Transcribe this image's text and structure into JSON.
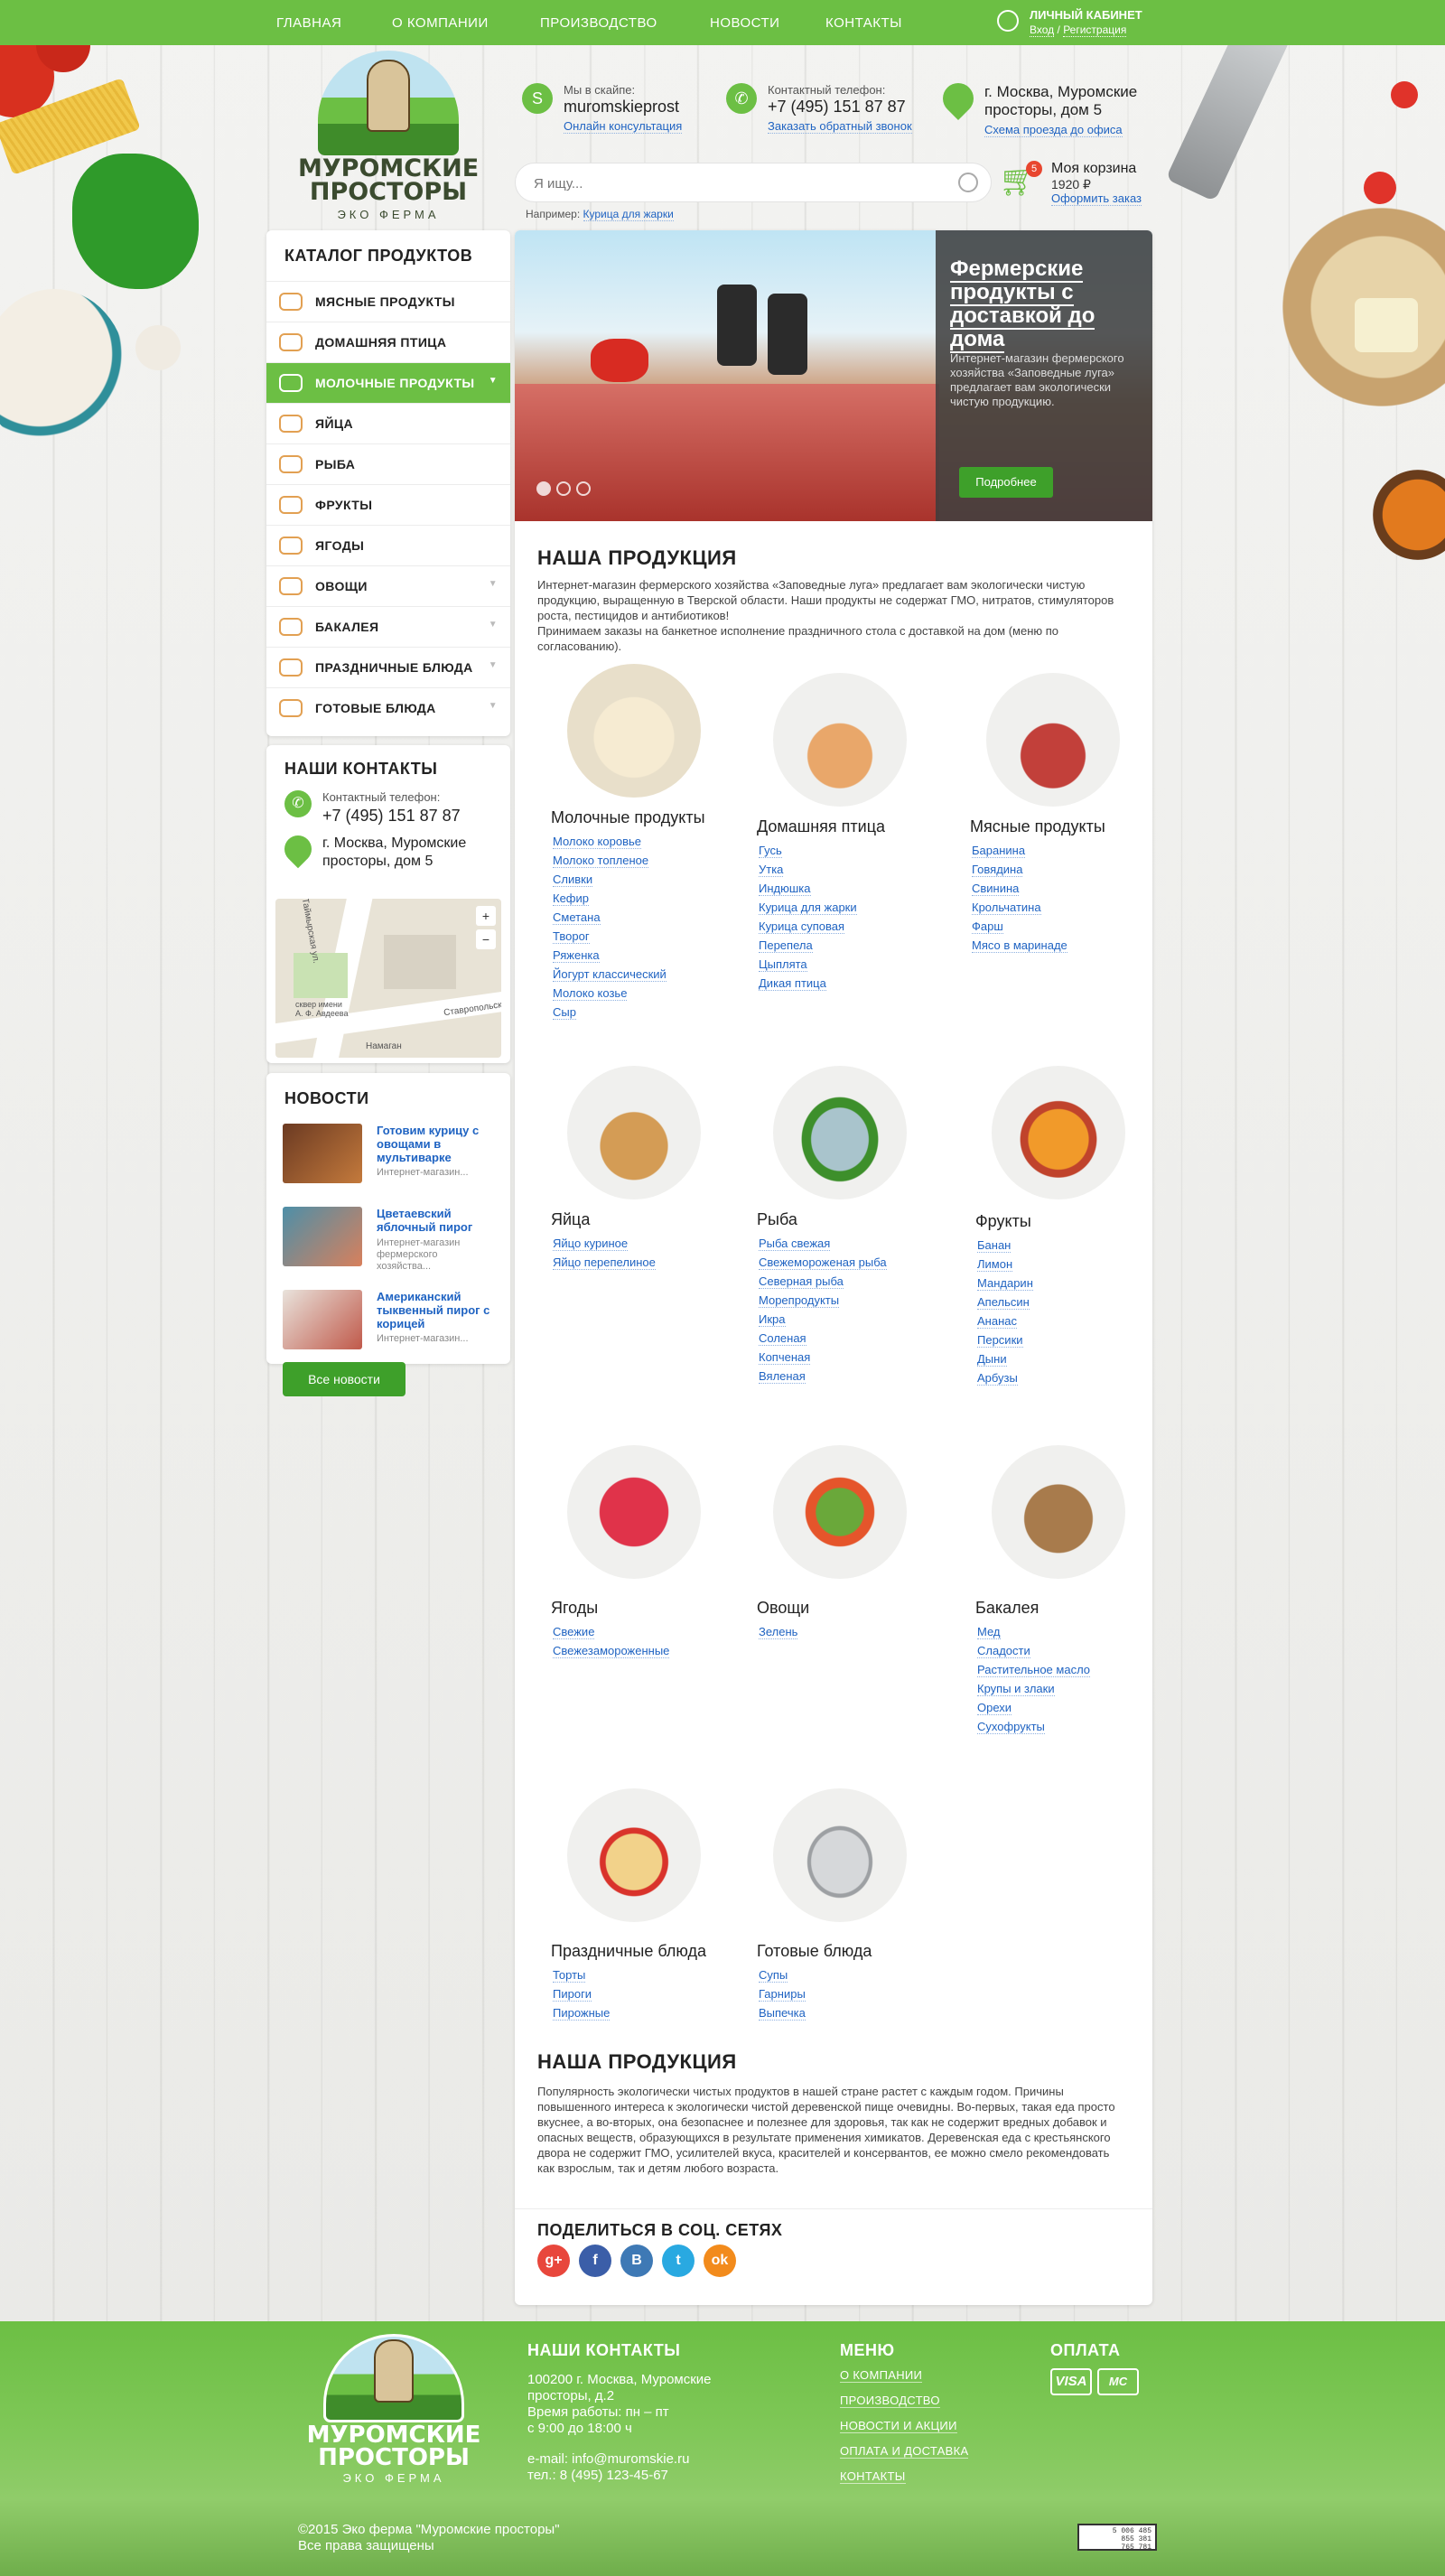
{
  "nav": {
    "items": [
      "ГЛАВНАЯ",
      "О КОМПАНИИ",
      "ПРОИЗВОДСТВО",
      "НОВОСТИ",
      "КОНТАКТЫ"
    ],
    "cabinet_title": "ЛИЧНЫЙ КАБИНЕТ",
    "login": "Вход",
    "separator": "/",
    "register": "Регистрация"
  },
  "logo": {
    "line1": "МУРОМСКИЕ",
    "line2": "ПРОСТОРЫ",
    "sub": "ЭКО ФЕРМА"
  },
  "header": {
    "skype_label": "Мы в скайпе:",
    "skype_value": "muromskieprost",
    "skype_link": "Онлайн консультация",
    "phone_label": "Контактный телефон:",
    "phone_value": "+7 (495) 151 87 87",
    "phone_link": "Заказать обратный звонок",
    "address_line1": "г. Москва, Муромские",
    "address_line2": "просторы, дом 5",
    "address_link": "Схема проезда до офиса"
  },
  "search": {
    "placeholder": "Я ищу...",
    "example_label": "Например:",
    "example_link": "Курица для жарки"
  },
  "cart": {
    "count": "5",
    "title": "Моя корзина",
    "sum": "1920 ₽",
    "link": "Оформить заказ"
  },
  "catalog": {
    "title": "КАТАЛОГ ПРОДУКТОВ",
    "items": [
      "МЯСНЫЕ ПРОДУКТЫ",
      "ДОМАШНЯЯ ПТИЦА",
      "МОЛОЧНЫЕ ПРОДУКТЫ",
      "ЯЙЦА",
      "РЫБА",
      "ФРУКТЫ",
      "ЯГОДЫ",
      "ОВОЩИ",
      "БАКАЛЕЯ",
      "ПРАЗДНИЧНЫЕ БЛЮДА",
      "ГОТОВЫЕ БЛЮДА"
    ]
  },
  "contacts": {
    "title": "НАШИ КОНТАКТЫ",
    "phone_label": "Контактный телефон:",
    "phone": "+7 (495) 151 87 87",
    "address1": "г. Москва, Муромские",
    "address2": "просторы, дом 5",
    "map_street1": "Таймырская ул.",
    "map_street2": "Ставропольская",
    "map_square": "сквер имени А. Ф. Авдеева",
    "map_shop": "Намаган",
    "map_zoom_in": "+",
    "map_zoom_out": "−"
  },
  "news": {
    "title": "НОВОСТИ",
    "items": [
      {
        "title": "Готовим курицу с овощами в мультиварке",
        "desc": "Интернет-магазин..."
      },
      {
        "title": "Цветаевский яблочный пирог",
        "desc": "Интернет-магазин фермерского хозяйства..."
      },
      {
        "title": "Американский тыквенный пирог с корицей",
        "desc": "Интернет-магазин..."
      }
    ],
    "all_button": "Все новости"
  },
  "banner": {
    "title": "Фермерские продукты с доставкой до дома",
    "desc": "Интернет-магазин фермерского хозяйства «Заповедные луга» предлагает вам экологически чистую продукцию.",
    "button": "Подробнее"
  },
  "products_section": {
    "title": "НАША ПРОДУКЦИЯ",
    "intro": "Интернет-магазин фермерского хозяйства «Заповедные луга» предлагает вам экологически чистую продукцию, выращенную в Тверской области. Наши продукты не содержат ГМО, нитратов, стимуляторов роста, пестицидов и антибиотиков!",
    "intro2": "Принимаем заказы на банкетное исполнение праздничного стола с доставкой на дом (меню по согласованию).",
    "categories": [
      {
        "title": "Молочные продукты",
        "links": [
          "Молоко коровье",
          "Молоко топленое",
          "Сливки",
          "Кефир",
          "Сметана",
          "Творог",
          "Ряженка",
          "Йогурт классический",
          "Молоко козье",
          "Сыр"
        ]
      },
      {
        "title": "Домашняя птица",
        "links": [
          "Гусь",
          "Утка",
          "Индюшка",
          "Курица для жарки",
          "Курица суповая",
          "Перепела",
          "Цыплята",
          "Дикая птица"
        ]
      },
      {
        "title": "Мясные продукты",
        "links": [
          "Баранина",
          "Говядина",
          "Свинина",
          "Крольчатина",
          "Фарш",
          "Мясо в маринаде"
        ]
      },
      {
        "title": "Яйца",
        "links": [
          "Яйцо куриное",
          "Яйцо перепелиное"
        ]
      },
      {
        "title": "Рыба",
        "links": [
          "Рыба свежая",
          "Свежемороженая рыба",
          "Северная рыба",
          "Морепродукты",
          "Икра",
          "Соленая",
          "Копченая",
          "Вяленая"
        ]
      },
      {
        "title": "Фрукты",
        "links": [
          "Банан",
          "Лимон",
          "Мандарин",
          "Апельсин",
          "Ананас",
          "Персики",
          "Дыни",
          "Арбузы"
        ]
      },
      {
        "title": "Ягоды",
        "links": [
          "Свежие",
          "Свежезамороженные"
        ]
      },
      {
        "title": "Овощи",
        "links": [
          "Зелень"
        ]
      },
      {
        "title": "Бакалея",
        "links": [
          "Мед",
          "Сладости",
          "Растительное масло",
          "Крупы и злаки",
          "Орехи",
          "Сухофрукты"
        ]
      },
      {
        "title": "Праздничные блюда",
        "links": [
          "Торты",
          "Пироги",
          "Пирожные"
        ]
      },
      {
        "title": "Готовые блюда",
        "links": [
          "Супы",
          "Гарниры",
          "Выпечка"
        ]
      }
    ]
  },
  "about_section": {
    "title": "НАША ПРОДУКЦИЯ",
    "text": "Популярность экологически чистых продуктов в нашей стране растет с каждым годом. Причины повышенного интереса к экологически чистой деревенской пище очевидны. Во-первых, такая еда просто вкуснее, а во-вторых, она безопаснее и полезнее для здоровья, так как не содержит вредных добавок и опасных веществ, образующихся в результате применения химикатов. Деревенская еда с крестьянского двора не содержит ГМО, усилителей вкуса, красителей и консервантов, ее можно смело рекомендовать как взрослым, так и детям любого возраста."
  },
  "social": {
    "title": "ПОДЕЛИТЬСЯ В СОЦ. СЕТЯХ",
    "items": [
      {
        "label": "g+",
        "color": "#e8473c"
      },
      {
        "label": "f",
        "color": "#3b5ea8"
      },
      {
        "label": "B",
        "color": "#3e79b5"
      },
      {
        "label": "t",
        "color": "#29a9e1"
      },
      {
        "label": "ok",
        "color": "#f28b1c"
      }
    ]
  },
  "footer": {
    "contacts_title": "НАШИ КОНТАКТЫ",
    "address1": "100200 г. Москва, Муромские",
    "address2": "просторы, д.2",
    "hours1": "Время работы: пн – пт",
    "hours2": "с 9:00 до 18:00 ч",
    "email": "e-mail: info@muromskie.ru",
    "phone": "тел.: 8 (495) 123-45-67",
    "menu_title": "МЕНЮ",
    "menu": [
      "О КОМПАНИИ",
      "ПРОИЗВОДСТВО",
      "НОВОСТИ И АКЦИИ",
      "ОПЛАТА И ДОСТАВКА",
      "КОНТАКТЫ"
    ],
    "pay_title": "ОПЛАТА",
    "pay1": "VISA",
    "pay2": "MC",
    "copyright1": "©2015 Эко ферма \"Муромские просторы\"",
    "copyright2": "Все права защищены",
    "counter1": "5 006 485",
    "counter2": "855 381",
    "counter3": "765 781"
  },
  "colors": {
    "accent": "#6cbf44",
    "button": "#3ea02a",
    "link": "#1f63c2"
  }
}
